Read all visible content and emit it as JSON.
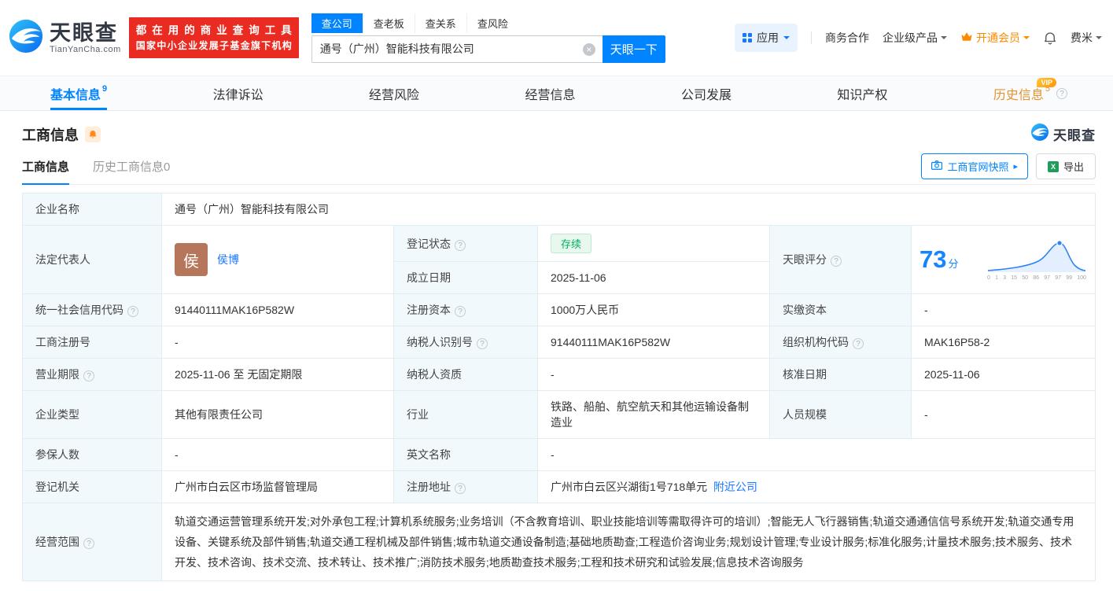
{
  "header": {
    "logo": {
      "brand": "天眼查",
      "domain": "TianYanCha.com"
    },
    "slogan": {
      "line1": "都在用的商业查询工具",
      "line2": "国家中小企业发展子基金旗下机构"
    },
    "search_tabs": [
      {
        "label": "查公司"
      },
      {
        "label": "查老板"
      },
      {
        "label": "查关系"
      },
      {
        "label": "查风险"
      }
    ],
    "search": {
      "value": "通号（广州）智能科技有限公司",
      "button": "天眼一下"
    },
    "menu": {
      "apps": "应用",
      "cooperation": "商务合作",
      "enterprise": "企业级产品",
      "vip": "开通会员",
      "username": "费米"
    }
  },
  "nav": {
    "items": [
      {
        "label": "基本信息",
        "badge": "9"
      },
      {
        "label": "法律诉讼",
        "badge": ""
      },
      {
        "label": "经营风险",
        "badge": ""
      },
      {
        "label": "经营信息",
        "badge": ""
      },
      {
        "label": "公司发展",
        "badge": ""
      },
      {
        "label": "知识产权",
        "badge": ""
      },
      {
        "label": "历史信息",
        "badge": "5",
        "tag": "VIP"
      }
    ]
  },
  "section": {
    "title": "工商信息",
    "brand": "天眼查",
    "tabs": [
      {
        "label": "工商信息"
      },
      {
        "label": "历史工商信息0"
      }
    ],
    "snapshot_button": "工商官网快照",
    "export_button": "导出"
  },
  "fields": {
    "company_name": {
      "label": "企业名称",
      "value": "通号（广州）智能科技有限公司"
    },
    "legal_rep": {
      "label": "法定代表人",
      "value": "侯博",
      "avatar": "侯"
    },
    "reg_status": {
      "label": "登记状态",
      "value": "存续"
    },
    "founded_date": {
      "label": "成立日期",
      "value": "2025-11-06"
    },
    "score": {
      "label": "天眼评分",
      "value": "73",
      "unit": "分"
    },
    "credit_code": {
      "label": "统一社会信用代码",
      "value": "91440111MAK16P582W"
    },
    "reg_capital": {
      "label": "注册资本",
      "value": "1000万人民币"
    },
    "paid_capital": {
      "label": "实缴资本",
      "value": "-"
    },
    "reg_number": {
      "label": "工商注册号",
      "value": "-"
    },
    "taxpayer_id": {
      "label": "纳税人识别号",
      "value": "91440111MAK16P582W"
    },
    "org_code": {
      "label": "组织机构代码",
      "value": "MAK16P58-2"
    },
    "business_term": {
      "label": "营业期限",
      "value": "2025-11-06 至 无固定期限"
    },
    "taxpayer_quality": {
      "label": "纳税人资质",
      "value": "-"
    },
    "approval_date": {
      "label": "核准日期",
      "value": "2025-11-06"
    },
    "company_type": {
      "label": "企业类型",
      "value": "其他有限责任公司"
    },
    "industry": {
      "label": "行业",
      "value": "铁路、船舶、航空航天和其他运输设备制造业"
    },
    "staff_size": {
      "label": "人员规模",
      "value": "-"
    },
    "insured_count": {
      "label": "参保人数",
      "value": "-"
    },
    "english_name": {
      "label": "英文名称",
      "value": "-"
    },
    "reg_authority": {
      "label": "登记机关",
      "value": "广州市白云区市场监督管理局"
    },
    "reg_address": {
      "label": "注册地址",
      "value": "广州市白云区兴湖街1号718单元",
      "link": "附近公司"
    },
    "business_scope": {
      "label": "经营范围",
      "value": "轨道交通运营管理系统开发;对外承包工程;计算机系统服务;业务培训（不含教育培训、职业技能培训等需取得许可的培训）;智能无人飞行器销售;轨道交通通信信号系统开发;轨道交通专用设备、关键系统及部件销售;轨道交通工程机械及部件销售;城市轨道交通设备制造;基础地质勘查;工程造价咨询业务;规划设计管理;专业设计服务;标准化服务;计量技术服务;技术服务、技术开发、技术咨询、技术交流、技术转让、技术推广;消防技术服务;地质勘查技术服务;工程和技术研究和试验发展;信息技术咨询服务"
    }
  },
  "score_chart": {
    "ticks": [
      "0",
      "1",
      "3",
      "15",
      "50",
      "86",
      "97",
      "97",
      "99",
      "100"
    ]
  }
}
